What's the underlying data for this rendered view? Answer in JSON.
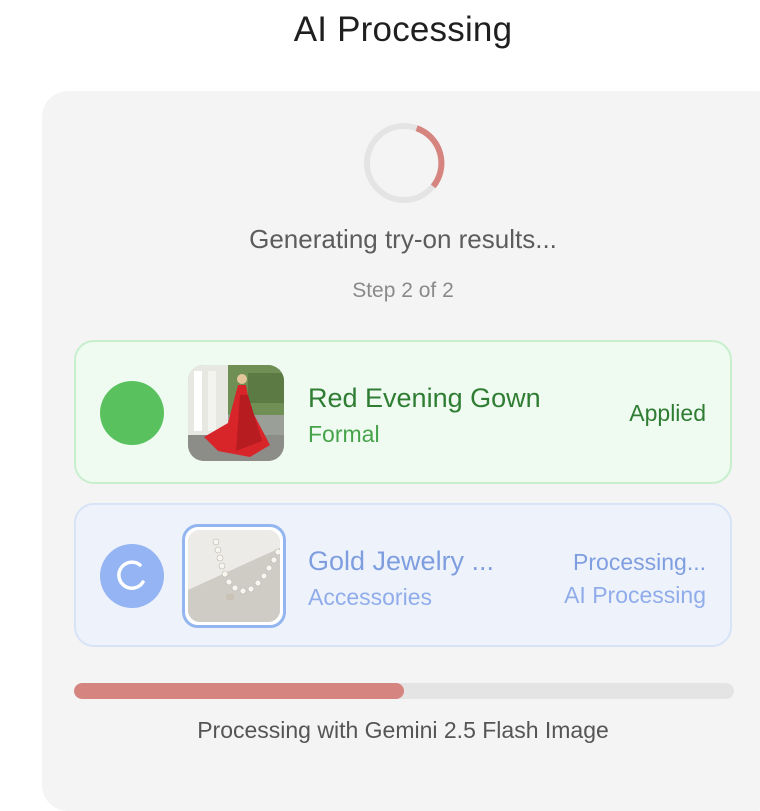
{
  "header": {
    "title": "AI Processing"
  },
  "status": {
    "message": "Generating try-on results...",
    "step": "Step 2 of 2"
  },
  "items": [
    {
      "name": "Red Evening Gown",
      "category": "Formal",
      "state": "Applied",
      "status_color": "#59c25e"
    },
    {
      "name": "Gold Jewelry ...",
      "category": "Accessories",
      "state": "Processing...",
      "substate": "AI Processing",
      "status_color": "#94b4f3"
    }
  ],
  "progress": {
    "fraction": 0.5,
    "color": "#d6847f"
  },
  "footer": {
    "text": "Processing with Gemini 2.5 Flash Image"
  },
  "colors": {
    "spinner_accent": "#d6847f",
    "spinner_track": "#e4e4e4",
    "done_bg": "#effbf1",
    "active_bg": "#eef3fb"
  },
  "icons": {
    "spinner": "loading-spinner-icon",
    "item2_status": "loading-ring-icon"
  }
}
